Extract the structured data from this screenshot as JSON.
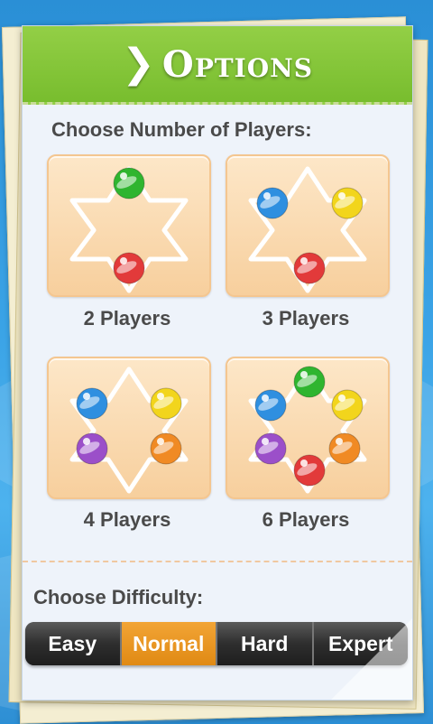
{
  "header": {
    "title": "Options",
    "chevron_icon": "chevron-right-icon"
  },
  "players": {
    "section_label": "Choose Number of Players:",
    "options": [
      {
        "label": "2 Players",
        "marbles": [
          "green",
          "red"
        ]
      },
      {
        "label": "3 Players",
        "marbles": [
          "blue",
          "yellow",
          "red"
        ]
      },
      {
        "label": "4 Players",
        "marbles": [
          "blue",
          "yellow",
          "purple",
          "orange"
        ]
      },
      {
        "label": "6 Players",
        "marbles": [
          "green",
          "blue",
          "yellow",
          "purple",
          "orange",
          "red"
        ]
      }
    ]
  },
  "difficulty": {
    "section_label": "Choose Difficulty:",
    "options": [
      "Easy",
      "Normal",
      "Hard",
      "Expert"
    ],
    "selected": "Normal"
  },
  "colors": {
    "header_green": "#86c63a",
    "selected_orange": "#e8941f",
    "card_peach": "#f9d9ae",
    "marble_green": "#2fb52f",
    "marble_red": "#e23a3a",
    "marble_blue": "#2f8fe0",
    "marble_yellow": "#f2d51c",
    "marble_purple": "#9b4fc9",
    "marble_orange": "#f08a24"
  }
}
